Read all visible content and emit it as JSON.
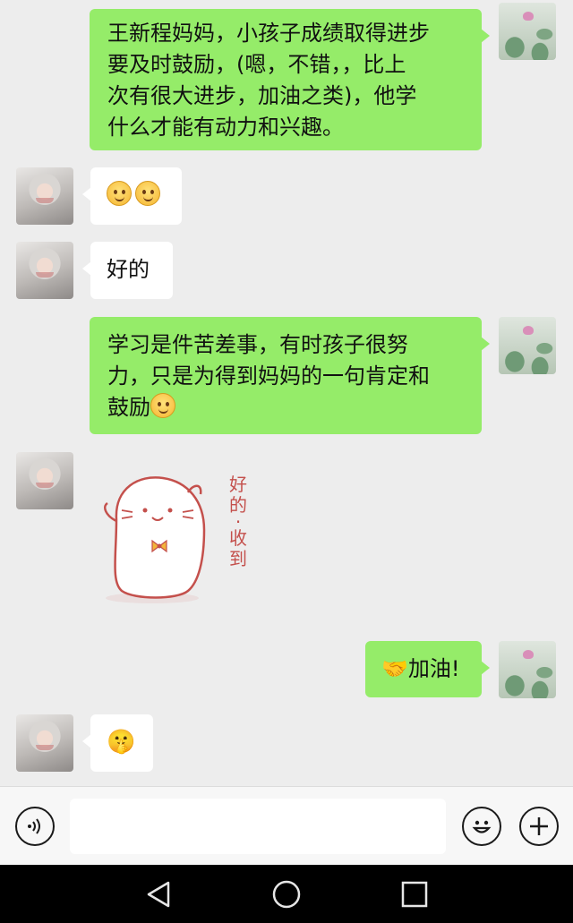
{
  "messages": [
    {
      "side": "self",
      "lines": [
        "王新程妈妈，小孩子成绩取得进步",
        "要及时鼓励，(嗯，不错，，比上",
        "次有很大进步，加油之类)，他学",
        "什么才能有动力和兴趣。"
      ]
    },
    {
      "side": "other",
      "emoji": "smile-emoji x2"
    },
    {
      "side": "other",
      "text": "好的"
    },
    {
      "side": "self",
      "lines": [
        "学习是件苦差事，有时孩子很努",
        "力，只是为得到妈妈的一句肯定和",
        "鼓励"
      ],
      "trailing_emoji": "smile-emoji"
    },
    {
      "side": "other",
      "sticker": {
        "name": "cat-sticker",
        "caption_chars": [
          "好",
          "的",
          "·",
          "收",
          "到"
        ]
      }
    },
    {
      "side": "self",
      "text": "🤝加油!"
    },
    {
      "side": "other",
      "text": "🤫"
    }
  ],
  "input_bar": {
    "voice_icon": "voice-icon",
    "input_placeholder": "",
    "emoji_icon": "emoji-icon",
    "plus_icon": "plus-icon"
  },
  "navbar": {
    "back_icon": "back-triangle-icon",
    "home_icon": "home-circle-icon",
    "recents_icon": "recents-square-icon"
  },
  "colors": {
    "chat_bg": "#ededed",
    "self_bubble": "#95ec69",
    "other_bubble": "#ffffff",
    "navbar": "#000000"
  }
}
